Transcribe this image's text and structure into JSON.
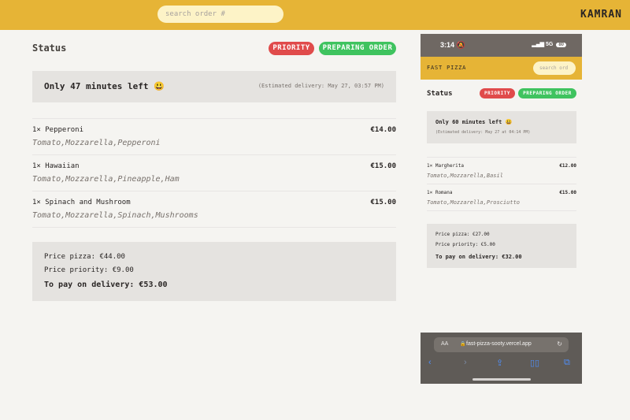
{
  "desktop": {
    "header": {
      "search_placeholder": "search order #",
      "username": "KAMRAN"
    },
    "status": {
      "title": "Status",
      "badges": {
        "priority": "PRIORITY",
        "preparing": "PREPARING ORDER"
      },
      "eta_text": "Only 47 minutes left 😃",
      "estimated_delivery": "(Estimated delivery: May 27, 03:57 PM)"
    },
    "items": [
      {
        "name": "1× Pepperoni",
        "price": "€14.00",
        "ingredients": "Tomato,Mozzarella,Pepperoni"
      },
      {
        "name": "1× Hawaiian",
        "price": "€15.00",
        "ingredients": "Tomato,Mozzarella,Pineapple,Ham"
      },
      {
        "name": "1× Spinach and Mushroom",
        "price": "€15.00",
        "ingredients": "Tomato,Mozzarella,Spinach,Mushrooms"
      }
    ],
    "summary": {
      "price_pizza": "Price pizza: €44.00",
      "price_priority": "Price priority: €9.00",
      "total": "To pay on delivery: €53.00"
    }
  },
  "mobile": {
    "statusbar": {
      "time": "3:14",
      "network": "5G",
      "battery": "80"
    },
    "header": {
      "logo": "FAST PIZZA",
      "search_placeholder": "search ord"
    },
    "status": {
      "title": "Status",
      "badges": {
        "priority": "PRIORITY",
        "preparing": "PREPARING ORDER"
      },
      "eta_text": "Only 60 minutes left 😃",
      "estimated_delivery": "(Estimated delivery: May 27 at 04:14 PM)"
    },
    "items": [
      {
        "name": "1× Margherita",
        "price": "€12.00",
        "ingredients": "Tomato,Mozzarella,Basil"
      },
      {
        "name": "1× Romana",
        "price": "€15.00",
        "ingredients": "Tomato,Mozzarella,Prosciutto"
      }
    ],
    "summary": {
      "price_pizza": "Price pizza: €27.00",
      "price_priority": "Price priority: €5.00",
      "total": "To pay on delivery: €32.00"
    },
    "browser": {
      "aa": "AA",
      "url": "fast-pizza-sooty.vercel.app"
    }
  },
  "colors": {
    "header": "#e6b436",
    "priority": "#e04b4b",
    "preparing": "#3fc35f",
    "panel": "#e5e3e0"
  }
}
